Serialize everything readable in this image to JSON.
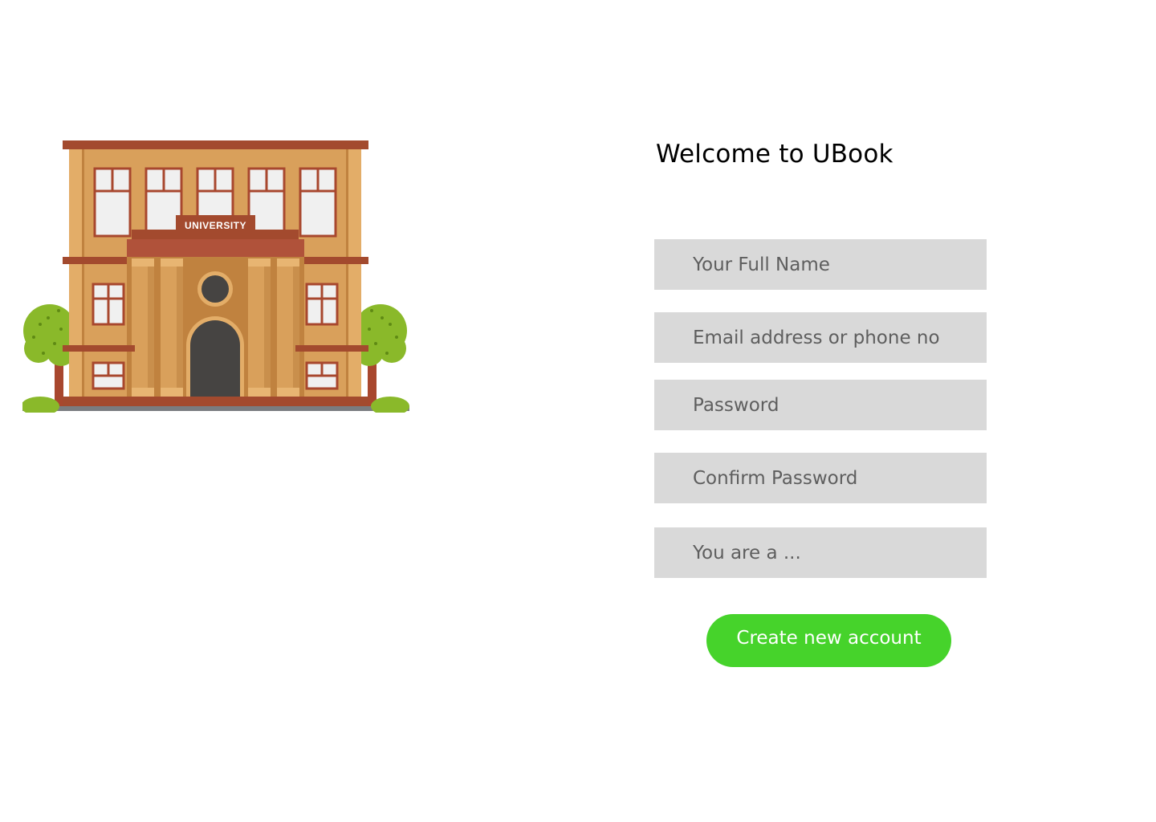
{
  "illustration": {
    "sign_text": "UNIVERSITY",
    "colors": {
      "roof": "#a34a2e",
      "wall": "#d9a05b",
      "wall_dark": "#c0823f",
      "window_frame": "#a8472e",
      "window_glass": "#f0f0f0",
      "door": "#464442",
      "tree": "#8ab92a",
      "ground": "#7a7c80"
    }
  },
  "signup": {
    "title": "Welcome to UBook",
    "full_name_placeholder": "Your Full Name",
    "email_placeholder": "Email address or phone no",
    "password_placeholder": "Password",
    "confirm_password_placeholder": "Confirm Password",
    "role_placeholder": "You are a ...",
    "create_button_label": "Create new account"
  },
  "theme": {
    "field_background": "#d9d9d9",
    "button_color": "#46d32b"
  }
}
